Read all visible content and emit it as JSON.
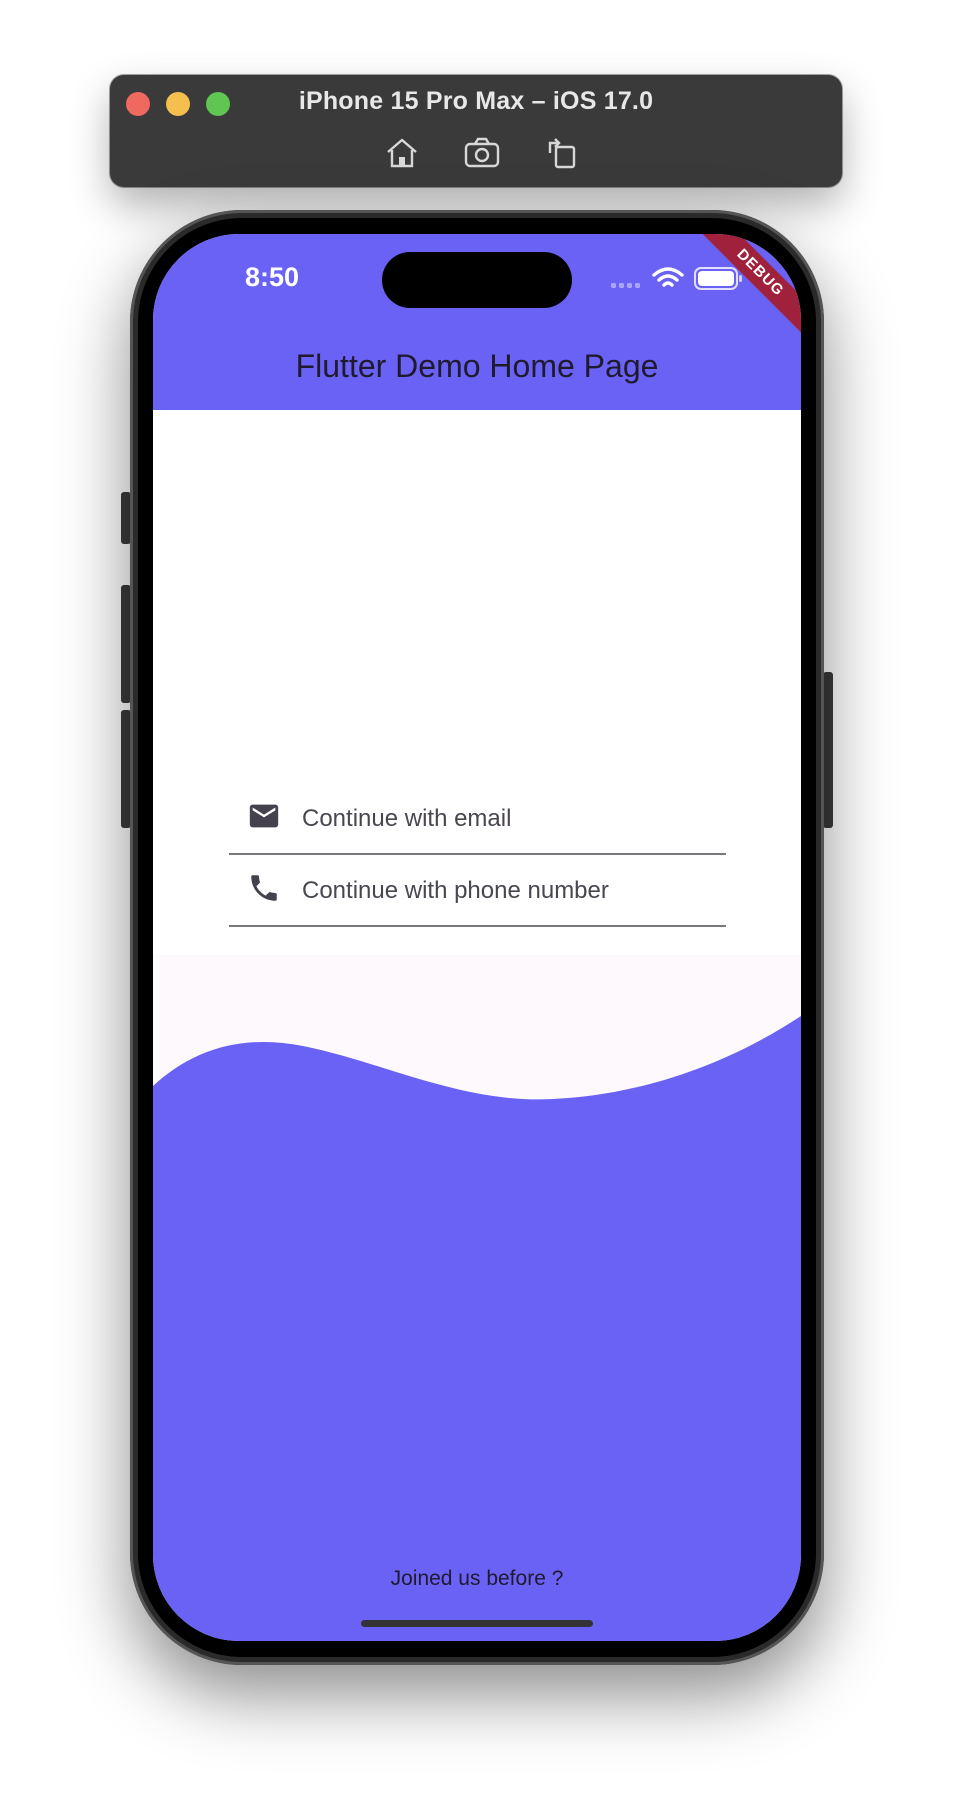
{
  "simulator": {
    "title": "iPhone 15 Pro Max – iOS 17.0",
    "buttons": [
      {
        "label": "Home",
        "icon": "home-icon"
      },
      {
        "label": "Screenshot",
        "icon": "camera-icon"
      },
      {
        "label": "Rotate",
        "icon": "rotate-icon"
      }
    ]
  },
  "status_bar": {
    "time": "8:50",
    "icons": [
      "signal-icon",
      "wifi-icon",
      "battery-icon"
    ]
  },
  "app_bar": {
    "title": "Flutter Demo Home Page",
    "debug_banner": "DEBUG"
  },
  "options": [
    {
      "label": "Continue with email",
      "icon": "email-icon"
    },
    {
      "label": "Continue with phone number",
      "icon": "phone-icon"
    }
  ],
  "footer": {
    "link": "Joined us before ?"
  },
  "colors": {
    "primary": "#6962f5",
    "surface": "#fdf9fc",
    "text": "#1f1b2e",
    "debug": "#a0213c"
  }
}
